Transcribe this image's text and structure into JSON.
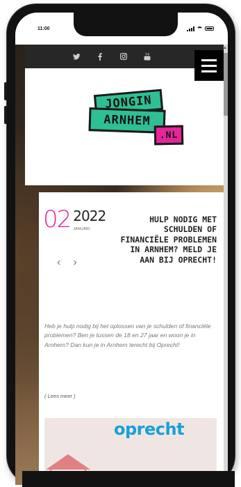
{
  "status_bar": {
    "time": "11:00"
  },
  "social_icons": [
    "twitter-icon",
    "facebook-icon",
    "instagram-icon",
    "youtube-icon"
  ],
  "logo": {
    "line1": "JONGIN",
    "line2": "ARNHEM",
    "line3": ".NL"
  },
  "post": {
    "day": "02",
    "year": "2022",
    "month": "JANUARI",
    "title": "HULP NODIG MET SCHULDEN OF FINANCIËLE PROBLEMEN IN ARNHEM? MELD JE AAN BIJ OPRECHT!",
    "prev": "‹",
    "next": "›",
    "excerpt": "Heb je hulp nodig bij het oplossen van je schulden of financiële problemen? Ben je tussen de 18 en 27 jaar en woon je in Arnhem? Dan kun je in Arnhem terecht bij Oprecht!",
    "read_more": "( Lees meer )"
  },
  "promo": {
    "brand": "oprecht"
  },
  "colors": {
    "accent_pink": "#e6259a",
    "logo_green": "#2fbf94",
    "brand_blue": "#1aa0d6"
  }
}
